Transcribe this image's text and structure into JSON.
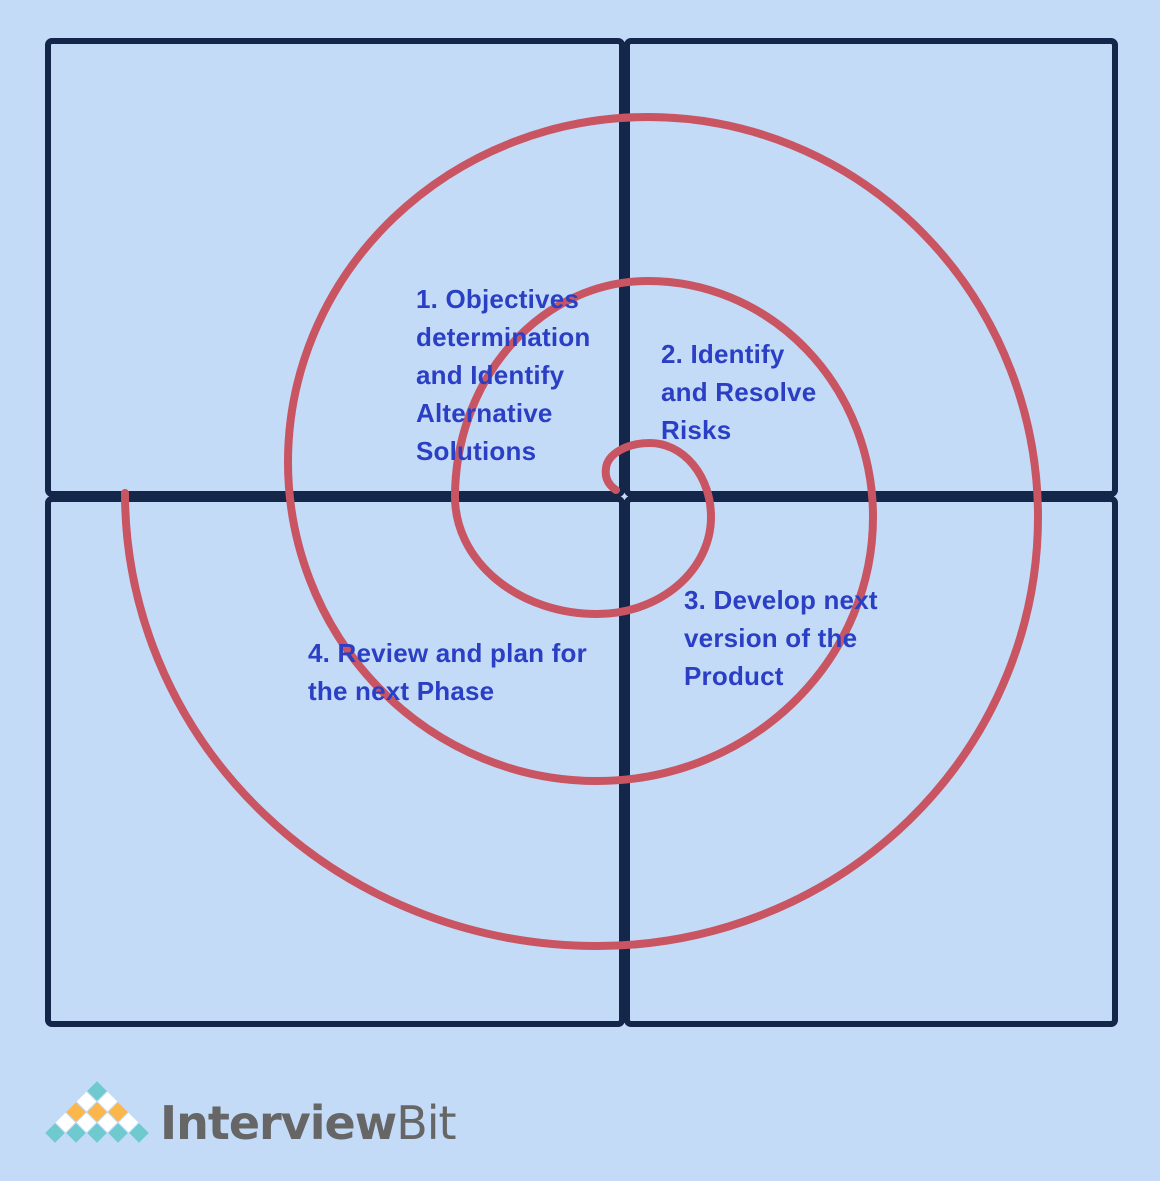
{
  "diagram": {
    "quadrants": [
      {
        "label": "1. Objectives\ndetermination\nand Identify\nAlternative\nSolutions"
      },
      {
        "label": "2. Identify\nand Resolve\nRisks"
      },
      {
        "label": "3. Develop next\nversion of the\nProduct"
      },
      {
        "label": "4. Review and plan for\nthe next Phase"
      }
    ],
    "colors": {
      "background": "#c4dbf7",
      "grid": "#14264a",
      "spiral": "#c95563",
      "text": "#2b3fc4"
    }
  },
  "logo": {
    "bold": "Interview",
    "light": "Bit"
  }
}
